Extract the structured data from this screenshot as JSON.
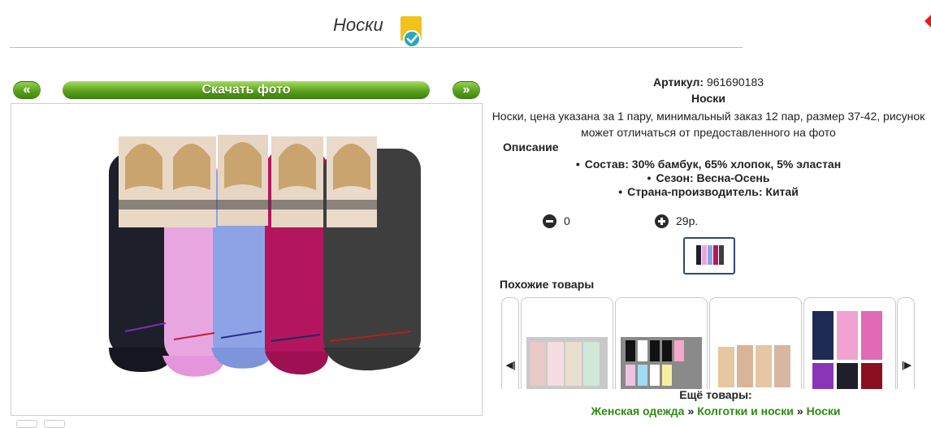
{
  "header": {
    "title": "Носки"
  },
  "photo_nav": {
    "prev_label": "«",
    "next_label": "»",
    "download_label": "Скачать фото"
  },
  "product": {
    "sku_label": "Артикул:",
    "sku_value": "961690183",
    "name": "Носки",
    "description": "Носки, цена указана за 1 пару, минимальный заказ 12 пар, размер 37-42, рисунок может отличаться от предоставленного на фото",
    "description_heading": "Описание",
    "specs": [
      "Состав: 30% бамбук, 65% хлопок, 5% эластан",
      "Сезон: Весна-Осень",
      "Страна-производитель: Китай"
    ]
  },
  "order": {
    "quantity": "0",
    "price": "29р."
  },
  "similar": {
    "heading": "Похожие товары"
  },
  "more": {
    "heading": "Ещё товары:",
    "breadcrumb": [
      "Женская одежда",
      "Колготки и носки",
      "Носки"
    ],
    "separator": "»"
  },
  "colors": {
    "button_green": "#5aa11c",
    "link_green": "#2d8a12",
    "thumb_border": "#2d4a6e",
    "sock_colors": [
      "#1d1f2a",
      "#e8a6e0",
      "#8da3e6",
      "#b3165f",
      "#3e3e3e"
    ]
  }
}
